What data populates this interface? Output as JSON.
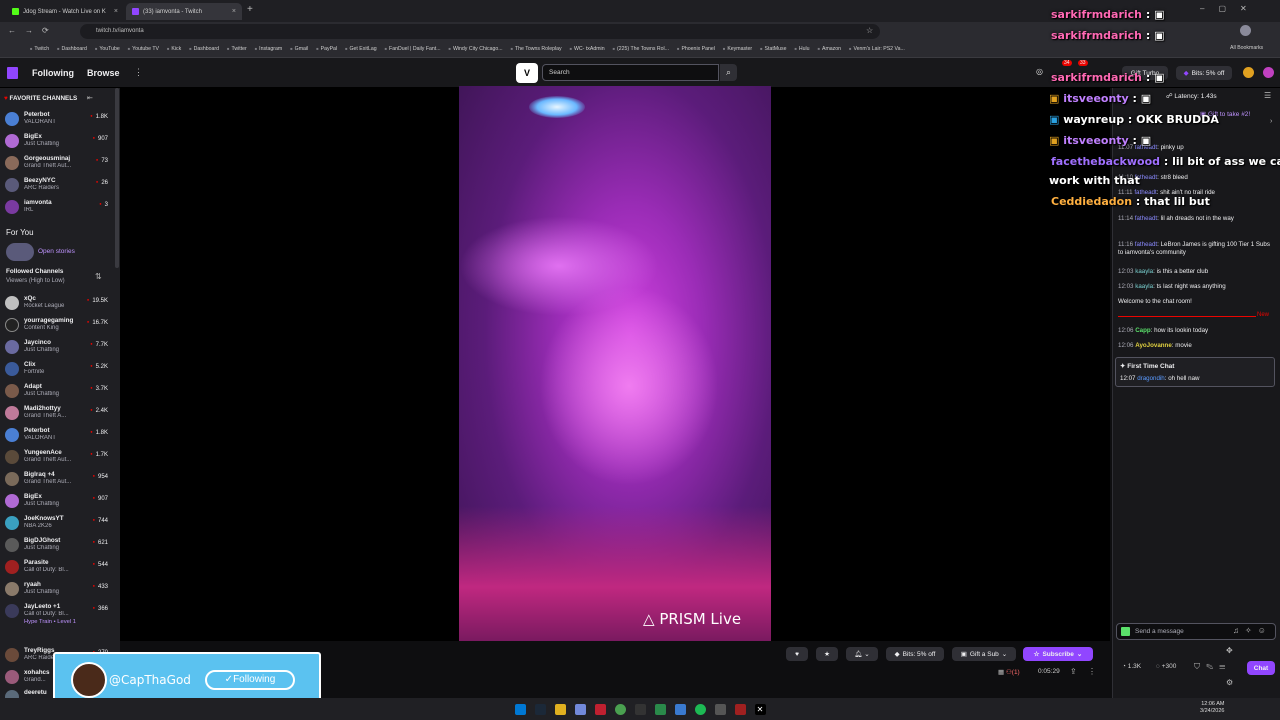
{
  "browser": {
    "tabs": [
      {
        "title": "Jdog Stream - Watch Live on K",
        "color": "#53fc18"
      },
      {
        "title": "(33) iamvonta - Twitch",
        "color": "#9146ff"
      }
    ],
    "url": "twitch.tv/iamvonta",
    "bookmarks": [
      "Twitch",
      "Dashboard",
      "YouTube",
      "Youtube TV",
      "Kick",
      "Dashboard",
      "Twitter",
      "Instagram",
      "Gmail",
      "PayPal",
      "Get ExitLag",
      "FanDuel | Daily Fant...",
      "Windy City Chicago...",
      "The Towns Roleplay",
      "WC- txAdmin",
      "(225) The Towns Rol...",
      "Phoenix Panel",
      "Keymaster",
      "StatMuse",
      "Hulu",
      "Amazon",
      "Venm's Lair: PS2 Va..."
    ],
    "all_bookmarks": "All Bookmarks"
  },
  "nav": {
    "following": "Following",
    "browse": "Browse",
    "search_placeholder": "Search",
    "gift_turbo": "Gift Turbo",
    "bits_off": "Bits: 5% off",
    "badge_count_1": "34",
    "badge_count_2": "33"
  },
  "sidebar": {
    "favorites_title": "FAVORITE CHANNELS",
    "favorites": [
      {
        "name": "Peterbot",
        "game": "VALORANT",
        "viewers": "1.8K",
        "color": "#4a7fd4"
      },
      {
        "name": "BigEx",
        "game": "Just Chatting",
        "viewers": "907",
        "color": "#b06ad4"
      },
      {
        "name": "Gorgeousminaj",
        "game": "Grand Theft Aut...",
        "viewers": "73",
        "color": "#8a6a5a"
      },
      {
        "name": "BeezyNYC",
        "game": "ARC Raiders",
        "viewers": "26",
        "color": "#5a5a7a"
      },
      {
        "name": "iamvonta",
        "game": "IRL",
        "viewers": "3",
        "color": "#7a3aa0"
      }
    ],
    "for_you": "For You",
    "open_stories": "Open stories",
    "followed_title": "Followed Channels",
    "followed_sub": "Viewers (High to Low)",
    "followed": [
      {
        "name": "xQc",
        "game": "Rocket League",
        "viewers": "19.5K",
        "color": "#c0c0c0"
      },
      {
        "name": "yourragegaming",
        "game": "Content King",
        "viewers": "16.7K",
        "color": "#222"
      },
      {
        "name": "Jaycinco",
        "game": "Just Chatting",
        "viewers": "7.7K",
        "color": "#6a6aa0"
      },
      {
        "name": "Clix",
        "game": "Fortnite",
        "viewers": "5.2K",
        "color": "#3a5a9a"
      },
      {
        "name": "Adapt",
        "game": "Just Chatting",
        "viewers": "3.7K",
        "color": "#7a5a4a"
      },
      {
        "name": "Madi2hottyy",
        "game": "Grand Theft A...",
        "viewers": "2.4K",
        "color": "#c07a9a"
      },
      {
        "name": "Peterbot",
        "game": "VALORANT",
        "viewers": "1.8K",
        "color": "#4a7fd4"
      },
      {
        "name": "YungeenAce",
        "game": "Grand Theft Aut...",
        "viewers": "1.7K",
        "color": "#5a4a3a"
      },
      {
        "name": "BigIraq +4",
        "game": "Grand Theft Aut...",
        "viewers": "954",
        "color": "#7a6a5a"
      },
      {
        "name": "BigEx",
        "game": "Just Chatting",
        "viewers": "907",
        "color": "#b06ad4"
      },
      {
        "name": "JoeKnowsYT",
        "game": "NBA 2K26",
        "viewers": "744",
        "color": "#3aa0c0"
      },
      {
        "name": "BigDJGhost",
        "game": "Just Chatting",
        "viewers": "621",
        "color": "#5a5a5a"
      },
      {
        "name": "Parasite",
        "game": "Call of Duty: Bl...",
        "viewers": "544",
        "color": "#a02020"
      },
      {
        "name": "ryaah",
        "game": "Just Chatting",
        "viewers": "433",
        "color": "#8a7a6a"
      },
      {
        "name": "JayLeeto +1",
        "game": "Call of Duty: Bl...",
        "viewers": "366",
        "color": "#3a3a5a"
      },
      {
        "name": "TreyRiggs",
        "game": "ARC Raiders",
        "viewers": "270",
        "color": "#6a4a3a"
      },
      {
        "name": "xohahcs",
        "game": "Grand...",
        "viewers": "",
        "color": "#9a5a7a"
      },
      {
        "name": "deeretu",
        "game": "",
        "viewers": "",
        "color": "#5a6a7a"
      }
    ],
    "hype_train": "Hype Train • Level 1"
  },
  "video": {
    "watermark": "PRISM Live"
  },
  "overlay_chat": [
    {
      "user": "sarkifrmdarich",
      "text": "",
      "color": "#ff69b4"
    },
    {
      "user": "sarkifrmdarich",
      "text": "",
      "color": "#ff69b4"
    },
    {
      "user": "sarkifrmdarich",
      "text": "",
      "color": "#ff69b4"
    },
    {
      "user": "itsveeonty",
      "text": "",
      "color": "#c080ff"
    },
    {
      "user": "waynreup",
      "text": "OKK BRUDDA",
      "color": "#ffffff"
    },
    {
      "user": "itsveeonty",
      "text": "",
      "color": "#c080ff"
    },
    {
      "user": "facethebackwood",
      "text": "lil bit of ass we can",
      "color": "#a070ff"
    },
    {
      "user": "",
      "text": "work with that",
      "color": "#ffffff"
    },
    {
      "user": "Ceddiedadon",
      "text": "that lil but",
      "color": "#ffb040"
    }
  ],
  "follow_alert": {
    "handle": "@CapThaGod",
    "button": "Following"
  },
  "chat": {
    "latency": "Latency: 1.43s",
    "gift_to_take": "Gift to take #2!",
    "messages": [
      {
        "time": "11:07",
        "user": "fatheadt",
        "text": "pinky up",
        "color": "#8a8aff"
      },
      {
        "time": "11:10",
        "user": "fatheadt",
        "text": "str8 bleed",
        "color": "#8a8aff"
      },
      {
        "time": "11:11",
        "user": "fatheadt",
        "text": "shit ain't no trail ride",
        "color": "#8a8aff"
      },
      {
        "time": "11:14",
        "user": "fatheadt",
        "text": "lil ah dreads not in the way",
        "color": "#8a8aff"
      },
      {
        "time": "11:16",
        "user": "fatheadt",
        "text": "LeBron James is gifting 100 Tier 1 Subs to iamvonta's community",
        "color": "#8a8aff"
      },
      {
        "time": "12:03",
        "user": "kaayla",
        "text": "is this a better club",
        "color": "#7ad1d1"
      },
      {
        "time": "12:03",
        "user": "kaayla",
        "text": "ts last night was anything",
        "color": "#7ad1d1"
      }
    ],
    "welcome": "Welcome to the chat room!",
    "new_label": "New",
    "new_messages": [
      {
        "time": "12:06",
        "user": "Capp",
        "text": "how its lookin today",
        "color": "#5ae06a"
      },
      {
        "time": "12:06",
        "user": "AyoJovanne",
        "text": "movie",
        "color": "#e0d040"
      }
    ],
    "first_time_title": "First Time Chat",
    "first_time_msg": {
      "time": "12:07",
      "user": "dragondih",
      "text": "oh hell naw",
      "color": "#5a9aff"
    },
    "input_placeholder": "Send a message",
    "viewers": "1.3K",
    "points": "+300",
    "chat_button": "Chat"
  },
  "controls": {
    "bits_off": "Bits: 5% off",
    "gift_sub": "Gift a Sub",
    "subscribe": "Subscribe",
    "uptime": "0:05:29",
    "viewer_count": "(1)"
  },
  "taskbar": {
    "time": "12:06 AM",
    "date": "3/24/2026"
  }
}
